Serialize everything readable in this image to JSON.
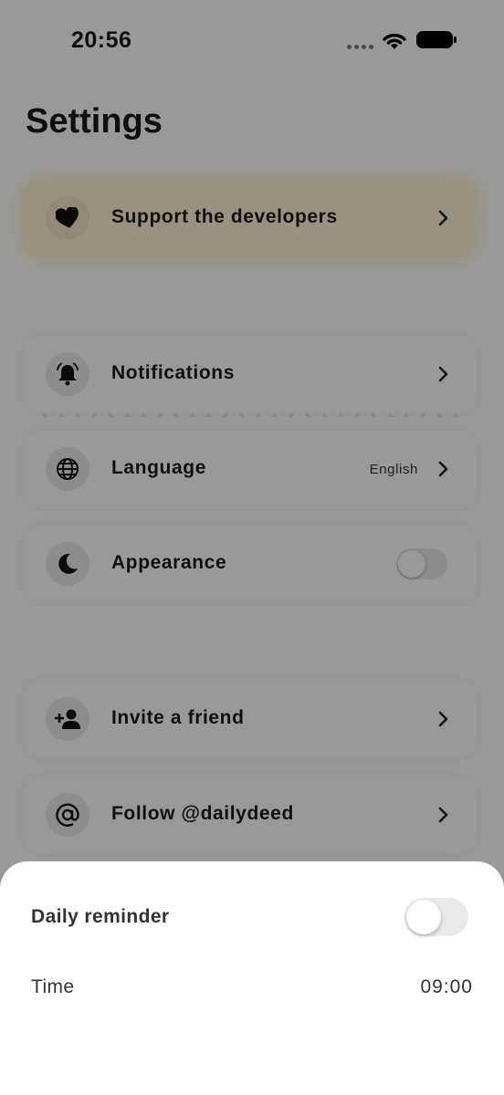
{
  "status_bar": {
    "time": "20:56"
  },
  "settings": {
    "title": "Settings",
    "support": {
      "label": "Support the developers",
      "icon": "heart-icon"
    },
    "notifications": {
      "label": "Notifications",
      "icon": "bell-icon"
    },
    "language": {
      "label": "Language",
      "value": "English",
      "icon": "globe-icon"
    },
    "appearance": {
      "label": "Appearance",
      "icon": "moon-icon",
      "dark_mode_on": false
    },
    "invite": {
      "label": "Invite a friend",
      "icon": "add-person-icon"
    },
    "follow": {
      "label": "Follow @dailydeed",
      "icon": "at-sign-icon"
    }
  },
  "sheet": {
    "daily_reminder_label": "Daily reminder",
    "daily_reminder_on": false,
    "time_label": "Time",
    "time_value": "09:00"
  },
  "colors": {
    "support_highlight": "#fff3d4",
    "overlay": "rgba(0,0,0,0.40)",
    "toggle_off": "#e9e9ea"
  }
}
